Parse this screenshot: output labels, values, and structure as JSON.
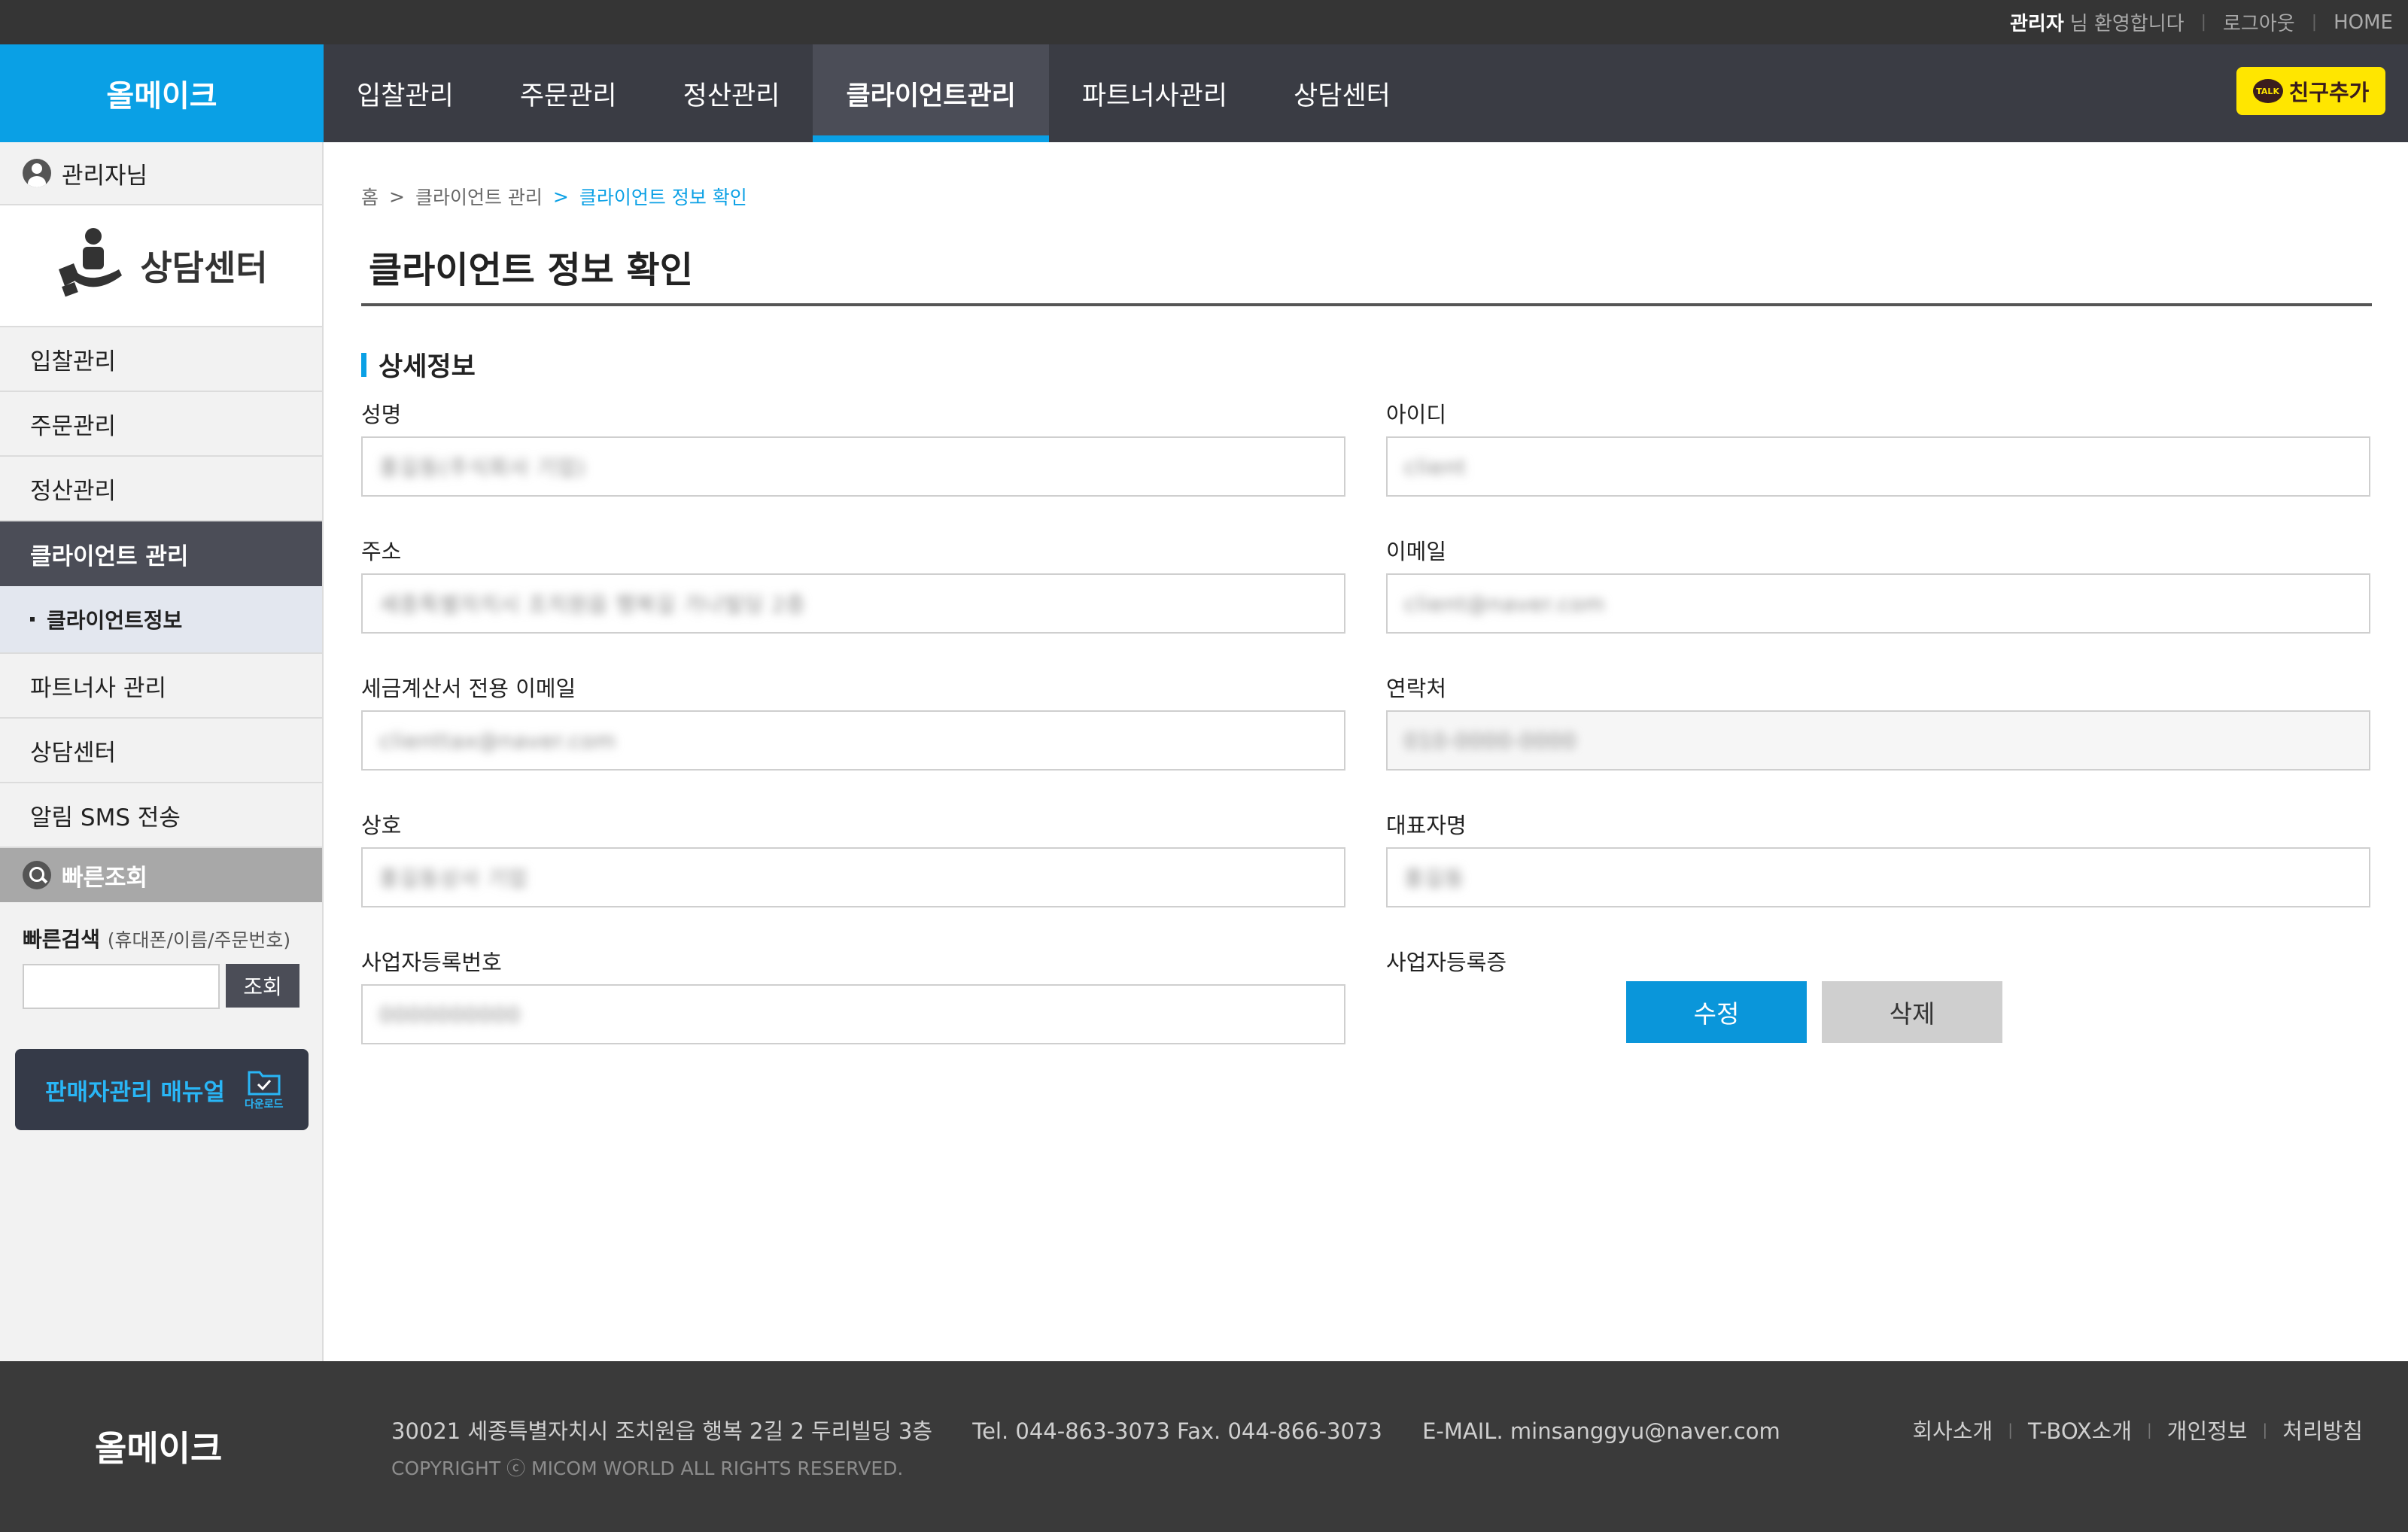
{
  "topbar": {
    "user": "관리자",
    "greeting": "님 환영합니다",
    "logout": "로그아웃",
    "home": "HOME"
  },
  "header": {
    "logo": "올메이크",
    "nav": [
      "입찰관리",
      "주문관리",
      "정산관리",
      "클라이언트관리",
      "파트너사관리",
      "상담센터"
    ],
    "active_nav": "클라이언트관리",
    "kakao_badge": "TALK",
    "kakao_label": "친구추가"
  },
  "sidebar": {
    "user_label": "관리자님",
    "title": "상담센터",
    "menu": [
      "입찰관리",
      "주문관리",
      "정산관리",
      "클라이언트 관리",
      "클라이언트정보",
      "파트너사 관리",
      "상담센터",
      "알림 SMS 전송"
    ],
    "quick_title": "빠른조회",
    "quick_label": "빠른검색",
    "quick_hint": "(휴대폰/이름/주문번호)",
    "quick_button": "조회",
    "manual_label": "판매자관리 매뉴얼",
    "manual_download": "다운로드"
  },
  "main": {
    "breadcrumb": [
      "홈",
      "클라이언트 관리",
      "클라이언트 정보 확인"
    ],
    "breadcrumb_sep": ">",
    "page_title": "클라이언트 정보 확인",
    "section_title": "상세정보",
    "fields": {
      "name_label": "성명",
      "name_value": "홍길동(주식회사 기업)",
      "id_label": "아이디",
      "id_value": "client",
      "address_label": "주소",
      "address_value": "세종특별자치시 조치원읍 행복길 가나빌딩 2층",
      "email_label": "이메일",
      "email_value": "client@naver.com",
      "tax_email_label": "세금계산서 전용 이메일",
      "tax_email_value": "clienttax@naver.com",
      "phone_label": "연락처",
      "phone_value": "010-0000-0000",
      "company_label": "상호",
      "company_value": "홍길동상사 기업",
      "ceo_label": "대표자명",
      "ceo_value": "홍길동",
      "bizno_label": "사업자등록번호",
      "bizno_value": "0000000000",
      "bizcert_label": "사업자등록증"
    },
    "edit_button": "수정",
    "delete_button": "삭제"
  },
  "footer": {
    "logo": "올메이크",
    "address": "30021 세종특별자치시 조치원읍 행복 2길 2 두리빌딩 3층",
    "tel": "Tel. 044-863-3073 Fax. 044-866-3073",
    "email": "E-MAIL. minsanggyu@naver.com",
    "copyright": "COPYRIGHT ⓒ MICOM WORLD ALL RIGHTS RESERVED.",
    "links": [
      "회사소개",
      "T-BOX소개",
      "개인정보",
      "처리방침"
    ]
  },
  "colors": {
    "accent": "#0aa0e5",
    "nav_bg": "#3a3c44",
    "footer_bg": "#3a3a3a",
    "kakao": "#ffe600"
  }
}
